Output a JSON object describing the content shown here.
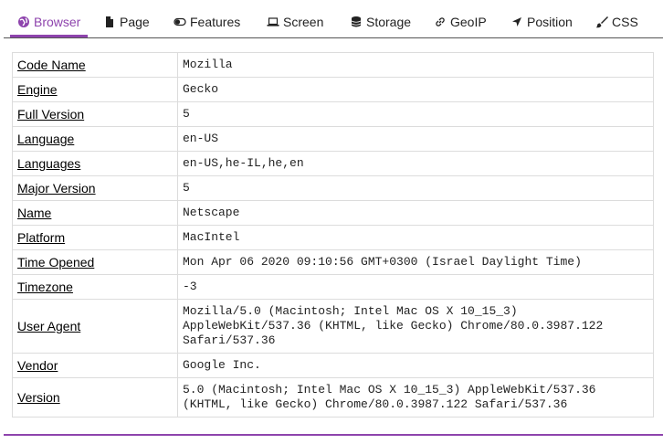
{
  "tabs": [
    {
      "label": "Browser",
      "icon": "globe-icon"
    },
    {
      "label": "Page",
      "icon": "file-icon"
    },
    {
      "label": "Features",
      "icon": "toggle-icon"
    },
    {
      "label": "Screen",
      "icon": "laptop-icon"
    },
    {
      "label": "Storage",
      "icon": "database-icon"
    },
    {
      "label": "GeoIP",
      "icon": "link-icon"
    },
    {
      "label": "Position",
      "icon": "location-arrow-icon"
    },
    {
      "label": "CSS",
      "icon": "paintbrush-icon"
    }
  ],
  "active_tab": "Browser",
  "accent_color": "#8e44ad",
  "rows": [
    {
      "key": "Code Name",
      "value": "Mozilla"
    },
    {
      "key": "Engine",
      "value": "Gecko"
    },
    {
      "key": "Full Version",
      "value": "5"
    },
    {
      "key": "Language",
      "value": "en-US"
    },
    {
      "key": "Languages",
      "value": "en-US,he-IL,he,en"
    },
    {
      "key": "Major Version",
      "value": "5"
    },
    {
      "key": "Name",
      "value": "Netscape"
    },
    {
      "key": "Platform",
      "value": "MacIntel"
    },
    {
      "key": "Time Opened",
      "value": "Mon Apr 06 2020 09:10:56 GMT+0300 (Israel Daylight Time)"
    },
    {
      "key": "Timezone",
      "value": "-3"
    },
    {
      "key": "User Agent",
      "value": "Mozilla/5.0 (Macintosh; Intel Mac OS X 10_15_3)\nAppleWebKit/537.36 (KHTML, like Gecko) Chrome/80.0.3987.122\nSafari/537.36"
    },
    {
      "key": "Vendor",
      "value": "Google Inc."
    },
    {
      "key": "Version",
      "value": "5.0 (Macintosh; Intel Mac OS X 10_15_3) AppleWebKit/537.36\n(KHTML, like Gecko) Chrome/80.0.3987.122 Safari/537.36"
    }
  ]
}
